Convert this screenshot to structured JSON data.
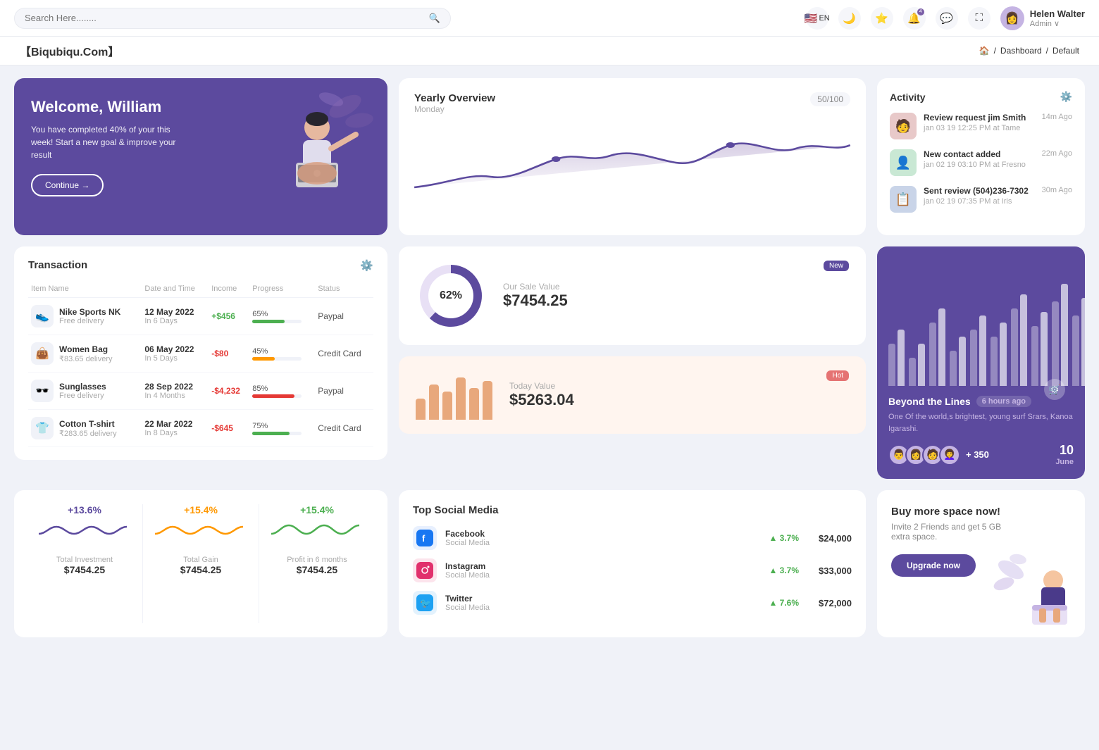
{
  "topnav": {
    "search_placeholder": "Search Here........",
    "lang": "EN",
    "user": {
      "name": "Helen Walter",
      "role": "Admin"
    }
  },
  "breadcrumb": {
    "brand": "【Biqubiqu.Com】",
    "path": [
      "Home",
      "Dashboard",
      "Default"
    ]
  },
  "welcome": {
    "title": "Welcome, William",
    "subtitle": "You have completed 40% of your this week! Start a new goal & improve your result",
    "btn_label": "Continue →"
  },
  "yearly_overview": {
    "title": "Yearly Overview",
    "day": "Monday",
    "badge": "50/100"
  },
  "activity": {
    "title": "Activity",
    "items": [
      {
        "title": "Review request jim Smith",
        "subtitle": "jan 03 19 12:25 PM at Tame",
        "time": "14m Ago"
      },
      {
        "title": "New contact added",
        "subtitle": "jan 02 19 03:10 PM at Fresno",
        "time": "22m Ago"
      },
      {
        "title": "Sent review (504)236-7302",
        "subtitle": "jan 02 19 07:35 PM at Iris",
        "time": "30m Ago"
      }
    ]
  },
  "transaction": {
    "title": "Transaction",
    "columns": [
      "Item Name",
      "Date and Time",
      "Income",
      "Progress",
      "Status"
    ],
    "rows": [
      {
        "name": "Nike Sports NK",
        "sub": "Free delivery",
        "date": "12 May 2022",
        "time": "In 6 Days",
        "income": "+$456",
        "income_type": "pos",
        "progress": 65,
        "progress_color": "#4caf50",
        "status": "Paypal",
        "icon": "👟"
      },
      {
        "name": "Women Bag",
        "sub": "₹83.65 delivery",
        "date": "06 May 2022",
        "time": "In 5 Days",
        "income": "-$80",
        "income_type": "neg",
        "progress": 45,
        "progress_color": "#ff9800",
        "status": "Credit Card",
        "icon": "👜"
      },
      {
        "name": "Sunglasses",
        "sub": "Free delivery",
        "date": "28 Sep 2022",
        "time": "In 4 Months",
        "income": "-$4,232",
        "income_type": "neg",
        "progress": 85,
        "progress_color": "#e53935",
        "status": "Paypal",
        "icon": "🕶️"
      },
      {
        "name": "Cotton T-shirt",
        "sub": "₹283.65 delivery",
        "date": "22 Mar 2022",
        "time": "In 8 Days",
        "income": "-$645",
        "income_type": "neg",
        "progress": 75,
        "progress_color": "#4caf50",
        "status": "Credit Card",
        "icon": "👕"
      }
    ]
  },
  "sale_value": {
    "badge": "New",
    "percent": "62%",
    "label": "Our Sale Value",
    "value": "$7454.25"
  },
  "today_value": {
    "badge": "Hot",
    "label": "Today Value",
    "value": "$5263.04",
    "bars": [
      30,
      50,
      40,
      60,
      45,
      55
    ]
  },
  "bar_chart": {
    "beyond_title": "Beyond the Lines",
    "time_ago": "6 hours ago",
    "description": "One Of the world,s brightest, young surf Srars, Kanoa Igarashi.",
    "plus_count": "+ 350",
    "date": "10",
    "month": "June"
  },
  "mini_stats": [
    {
      "pct": "+13.6%",
      "label": "Total Investment",
      "value": "$7454.25",
      "color": "#5c4a9e"
    },
    {
      "pct": "+15.4%",
      "label": "Total Gain",
      "value": "$7454.25",
      "color": "#ff9800"
    },
    {
      "pct": "+15.4%",
      "label": "Profit in 6 months",
      "value": "$7454.25",
      "color": "#4caf50"
    }
  ],
  "social_media": {
    "title": "Top Social Media",
    "items": [
      {
        "name": "Facebook",
        "sub": "Social Media",
        "pct": "3.7%",
        "amount": "$24,000",
        "color": "#1877f2",
        "icon": "f"
      },
      {
        "name": "Instagram",
        "sub": "Social Media",
        "pct": "3.7%",
        "amount": "$33,000",
        "color": "#e1306c",
        "icon": "📷"
      },
      {
        "name": "Twitter",
        "sub": "Social Media",
        "pct": "7.6%",
        "amount": "$72,000",
        "color": "#1da1f2",
        "icon": "🐦"
      }
    ]
  },
  "buy_space": {
    "title": "Buy more space now!",
    "subtitle": "Invite 2 Friends and get 5 GB extra space.",
    "btn_label": "Upgrade now"
  }
}
